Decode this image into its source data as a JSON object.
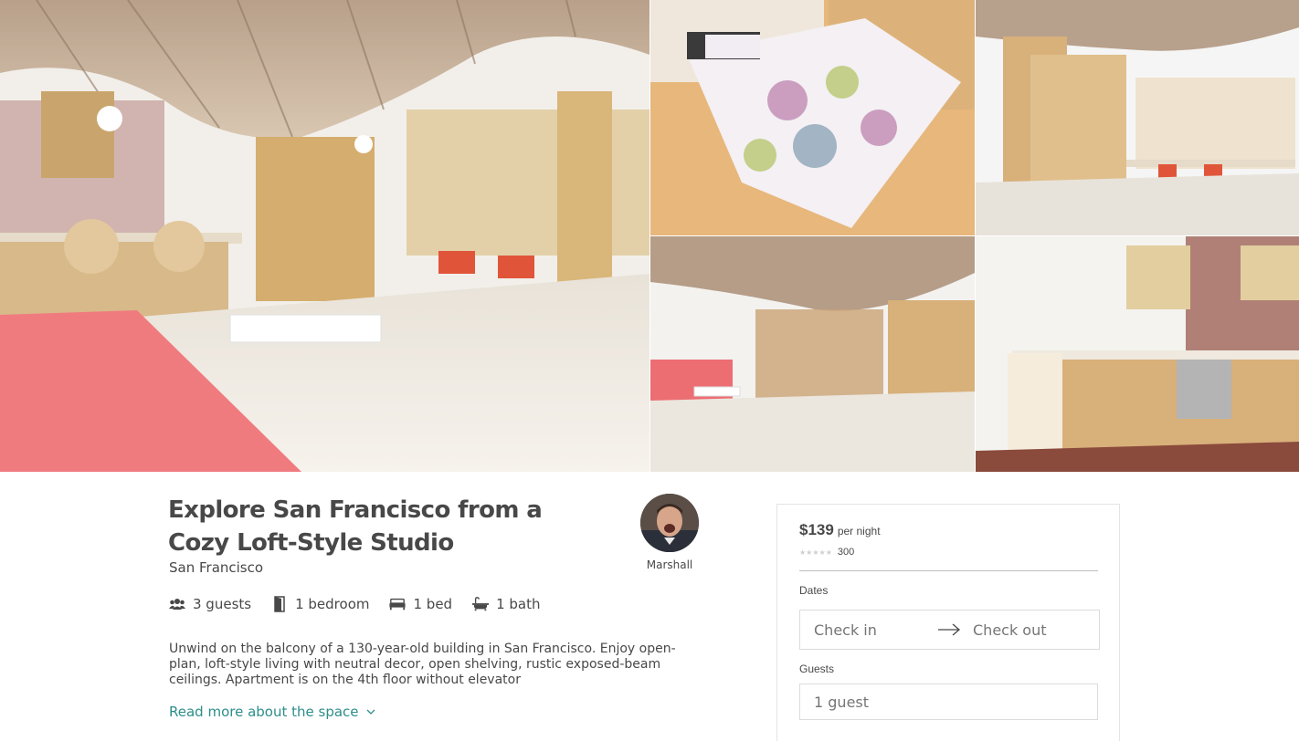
{
  "listing": {
    "title": "Explore San Francisco from a Cozy Loft-Style Studio",
    "city": "San Francisco",
    "host_name": "Marshall",
    "facts": {
      "guests": "3 guests",
      "bedrooms": "1 bedroom",
      "beds": "1 bed",
      "baths": "1 bath"
    },
    "description": "Unwind on the balcony of a 130-year-old building in San Francisco. Enjoy open-plan, loft-style living with neutral decor, open shelving, rustic exposed-beam ceilings. Apartment is on the 4th floor without elevator",
    "read_more": "Read more about the space"
  },
  "booking": {
    "price": "$139",
    "per_night": "per night",
    "review_count": "300",
    "rating_stars": 0,
    "dates_label": "Dates",
    "check_in": "Check in",
    "check_out": "Check out",
    "guests_label": "Guests",
    "guests_value": "1 guest"
  },
  "gallery": {
    "photos": [
      "main-living-room",
      "bedroom",
      "shelving-desk",
      "living-area",
      "kitchen"
    ]
  },
  "colors": {
    "accent_teal": "#2d8e8a",
    "text": "#484848",
    "border": "#e4e4e4"
  },
  "icons": [
    "guests-icon",
    "door-icon",
    "bed-icon",
    "bath-icon",
    "chevron-down-icon",
    "arrow-right-icon",
    "star-icon"
  ]
}
